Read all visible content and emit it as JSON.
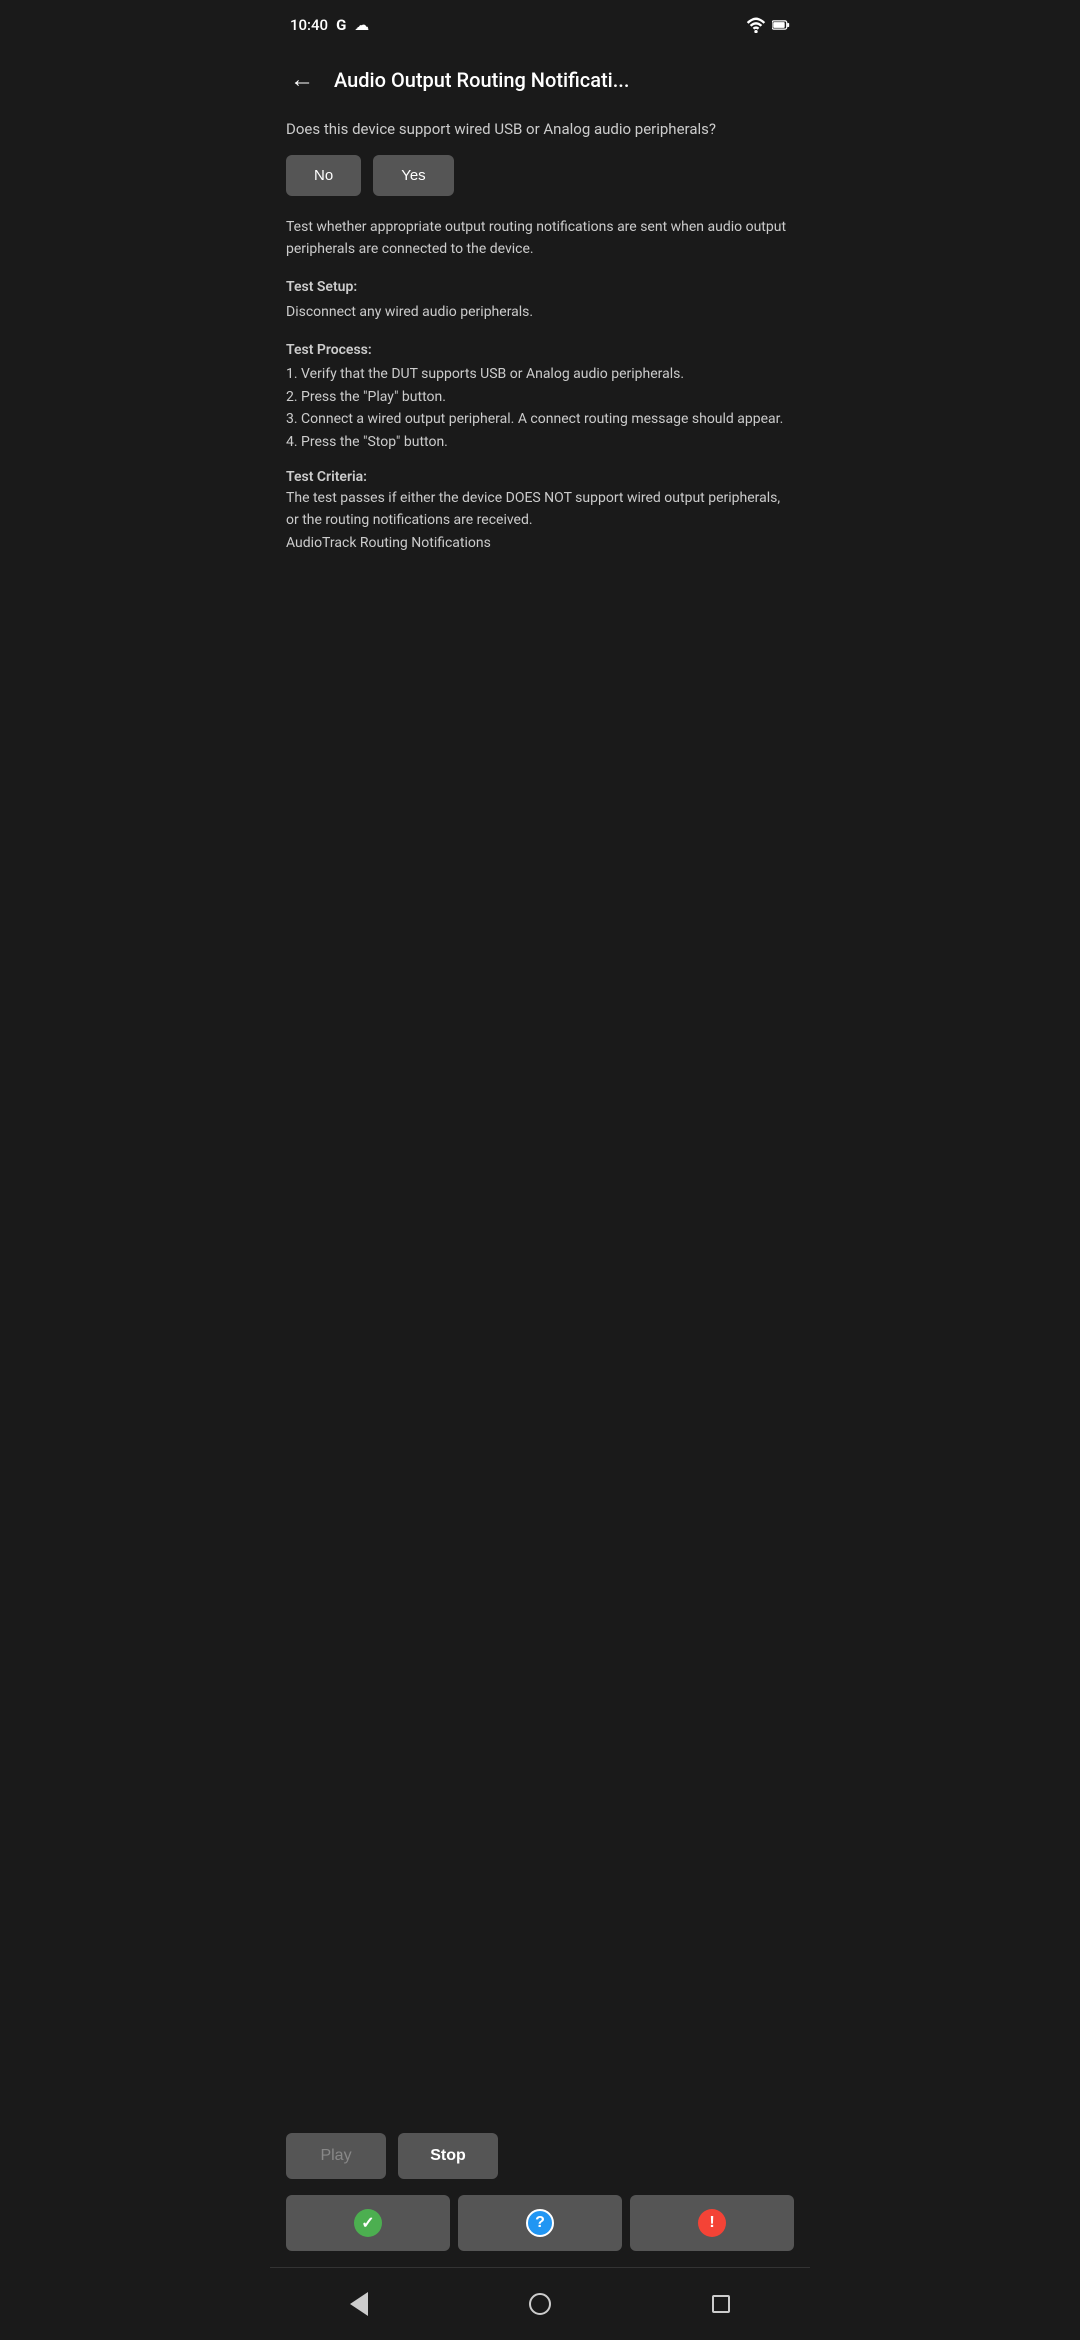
{
  "statusBar": {
    "time": "10:40",
    "googleIcon": "G",
    "cloudIcon": "☁"
  },
  "header": {
    "backIcon": "←",
    "title": "Audio Output Routing Notificati..."
  },
  "content": {
    "question": "Does this device support wired USB or Analog audio peripherals?",
    "noButton": "No",
    "yesButton": "Yes",
    "description": "Test whether appropriate output routing notifications are sent when audio output peripherals are connected to the device.",
    "testSetupTitle": "Test Setup:",
    "testSetupText": "Disconnect any wired audio peripherals.",
    "testProcessTitle": "Test Process:",
    "testProcessLines": [
      "1. Verify that the DUT supports USB or Analog audio peripherals.",
      "2. Press the \"Play\" button.",
      "3. Connect a wired output peripheral. A connect routing message should appear.",
      "4. Press the \"Stop\" button."
    ],
    "testCriteriaTitle": "Test Criteria:",
    "testCriteriaText": "The test passes if either the device DOES NOT support wired output peripherals, or the routing notifications are received.",
    "testCriteriaNote": "AudioTrack Routing Notifications"
  },
  "actionButtons": {
    "playLabel": "Play",
    "stopLabel": "Stop"
  },
  "statusButtons": {
    "passIcon": "✓",
    "infoIcon": "?",
    "failIcon": "!"
  },
  "navBar": {
    "backLabel": "back",
    "homeLabel": "home",
    "recentLabel": "recent"
  }
}
